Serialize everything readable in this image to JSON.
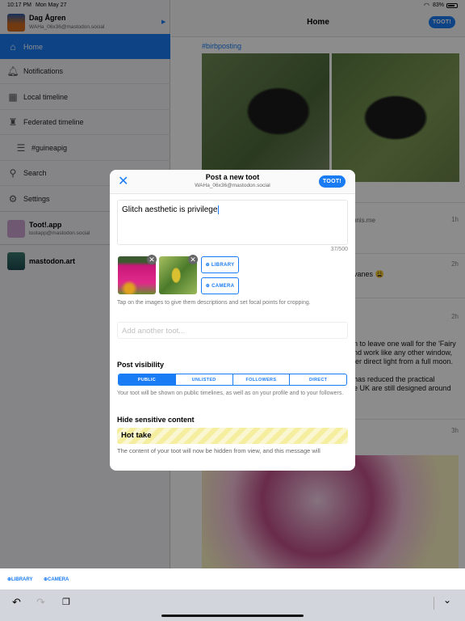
{
  "status_bar": {
    "time": "10:17 PM",
    "date": "Mon May 27",
    "battery": "83%"
  },
  "sidebar": {
    "account": {
      "name": "Dag Ågren",
      "handle": "WAHa_06x36@mastodon.social"
    },
    "items": [
      {
        "label": "Home",
        "icon": "home-icon",
        "active": true
      },
      {
        "label": "Notifications",
        "icon": "bell-icon"
      },
      {
        "label": "Local timeline",
        "icon": "local-timeline-icon"
      },
      {
        "label": "Federated timeline",
        "icon": "federated-timeline-icon"
      },
      {
        "label": "#guineapig",
        "icon": "list-icon"
      },
      {
        "label": "Search",
        "icon": "search-icon"
      },
      {
        "label": "Settings",
        "icon": "gear-icon"
      }
    ],
    "other_accounts": [
      {
        "name": "Toot!.app",
        "handle": "tootapp@mastodon.social"
      },
      {
        "name": "mastodon.art",
        "handle": ""
      }
    ]
  },
  "main": {
    "title": "Home",
    "toot_label": "TOOT!",
    "hashtag": "#birbposting",
    "timeline": [
      {
        "fragment": "rtunis.me",
        "time": "1h"
      },
      {
        "fragment": "vanes 😩",
        "time": "2h"
      },
      {
        "fragment_lines": [
          "n to leave one wall for the 'Fairy",
          "nd work like any other window,",
          "ler direct light from a full moon.",
          "",
          "has reduced the practical",
          "e UK are still designed around"
        ],
        "time": "2h"
      },
      {
        "time": "3h"
      }
    ]
  },
  "modal": {
    "title": "Post a new toot",
    "subtitle": "WAHa_06x36@mastodon.social",
    "toot_label": "TOOT!",
    "text": "Glitch aesthetic is privilege",
    "counter": "37/500",
    "library_label": "LIBRARY",
    "camera_label": "CAMERA",
    "hint": "Tap on the images to give them descriptions and set focal points for cropping.",
    "add_placeholder": "Add another toot...",
    "visibility_heading": "Post visibility",
    "visibility_options": [
      "PUBLIC",
      "UNLISTED",
      "FOLLOWERS",
      "DIRECT"
    ],
    "visibility_selected": "PUBLIC",
    "visibility_desc": "Your toot will be shown on public timelines, as well as on your profile and to your followers.",
    "sensitive_heading": "Hide sensitive content",
    "content_warning": "Hot take",
    "sensitive_desc": "The content of your toot will now be hidden from view, and this message will"
  },
  "accessory": {
    "library_label": "LIBRARY",
    "camera_label": "CAMERA"
  },
  "colors": {
    "accent": "#1a7cf5",
    "warning_stripe": "#f5ee9e"
  }
}
